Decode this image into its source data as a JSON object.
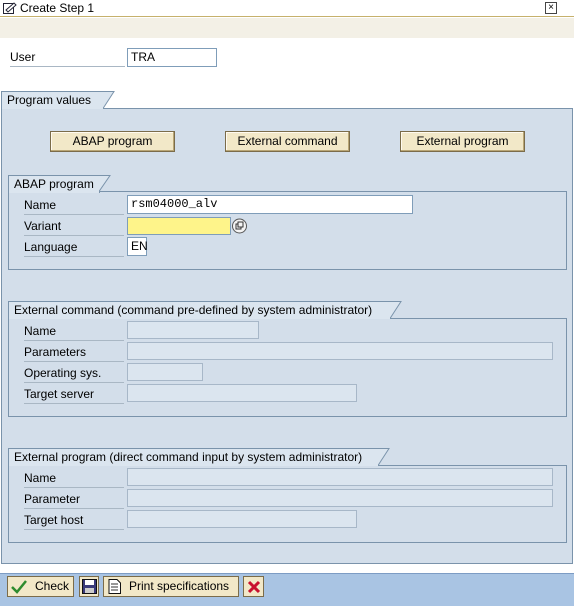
{
  "window": {
    "title": "Create Step  1",
    "close_label": "×"
  },
  "user": {
    "label": "User",
    "value": "TRA"
  },
  "program_values": {
    "title": "Program values",
    "buttons": {
      "abap": "ABAP program",
      "external_command": "External command",
      "external_program": "External program"
    }
  },
  "abap_program": {
    "title": "ABAP program",
    "name_label": "Name",
    "name_value": "rsm04000_alv",
    "variant_label": "Variant",
    "variant_value": "",
    "language_label": "Language",
    "language_value": "EN"
  },
  "external_command": {
    "title": "External command (command pre-defined by system administrator)",
    "name_label": "Name",
    "parameters_label": "Parameters",
    "os_label": "Operating sys.",
    "target_server_label": "Target server"
  },
  "external_program": {
    "title": "External program (direct command input by system administrator)",
    "name_label": "Name",
    "parameter_label": "Parameter",
    "target_host_label": "Target host"
  },
  "toolbar": {
    "check_label": "Check",
    "print_label": "Print specifications"
  },
  "colors": {
    "frame_bg": "#d3deea",
    "required_field": "#fef48a",
    "toolbar_bg": "#a9c4e3",
    "button_bg": "#f2e8c8"
  }
}
